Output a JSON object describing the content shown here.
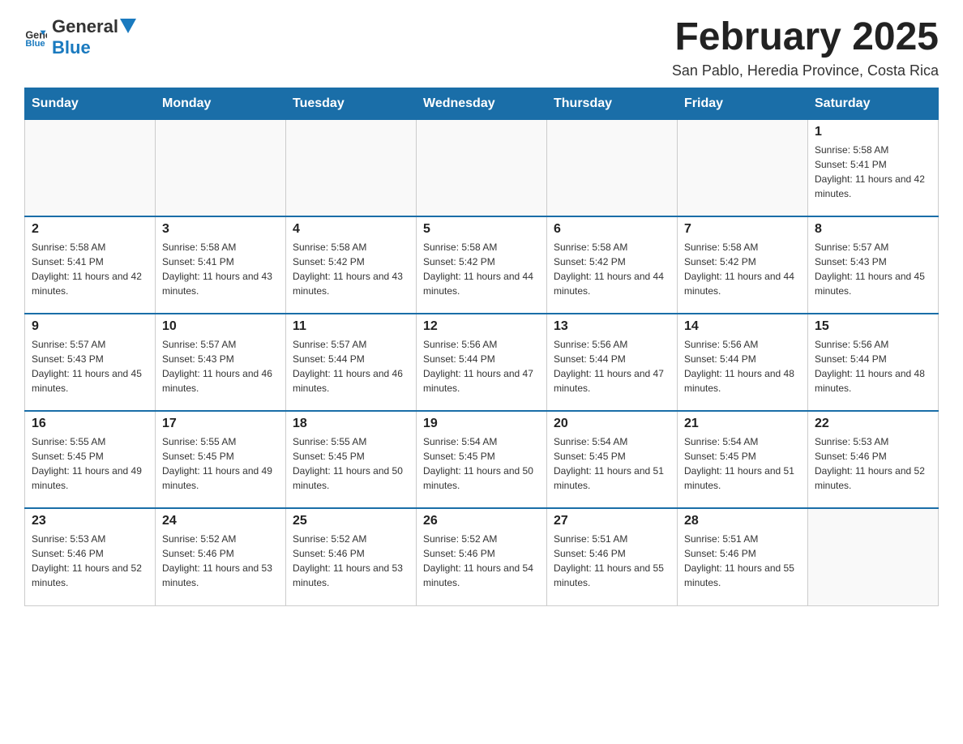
{
  "header": {
    "logo_general": "General",
    "logo_blue": "Blue",
    "title": "February 2025",
    "subtitle": "San Pablo, Heredia Province, Costa Rica"
  },
  "days_of_week": [
    "Sunday",
    "Monday",
    "Tuesday",
    "Wednesday",
    "Thursday",
    "Friday",
    "Saturday"
  ],
  "weeks": [
    [
      {
        "day": "",
        "sunrise": "",
        "sunset": "",
        "daylight": ""
      },
      {
        "day": "",
        "sunrise": "",
        "sunset": "",
        "daylight": ""
      },
      {
        "day": "",
        "sunrise": "",
        "sunset": "",
        "daylight": ""
      },
      {
        "day": "",
        "sunrise": "",
        "sunset": "",
        "daylight": ""
      },
      {
        "day": "",
        "sunrise": "",
        "sunset": "",
        "daylight": ""
      },
      {
        "day": "",
        "sunrise": "",
        "sunset": "",
        "daylight": ""
      },
      {
        "day": "1",
        "sunrise": "Sunrise: 5:58 AM",
        "sunset": "Sunset: 5:41 PM",
        "daylight": "Daylight: 11 hours and 42 minutes."
      }
    ],
    [
      {
        "day": "2",
        "sunrise": "Sunrise: 5:58 AM",
        "sunset": "Sunset: 5:41 PM",
        "daylight": "Daylight: 11 hours and 42 minutes."
      },
      {
        "day": "3",
        "sunrise": "Sunrise: 5:58 AM",
        "sunset": "Sunset: 5:41 PM",
        "daylight": "Daylight: 11 hours and 43 minutes."
      },
      {
        "day": "4",
        "sunrise": "Sunrise: 5:58 AM",
        "sunset": "Sunset: 5:42 PM",
        "daylight": "Daylight: 11 hours and 43 minutes."
      },
      {
        "day": "5",
        "sunrise": "Sunrise: 5:58 AM",
        "sunset": "Sunset: 5:42 PM",
        "daylight": "Daylight: 11 hours and 44 minutes."
      },
      {
        "day": "6",
        "sunrise": "Sunrise: 5:58 AM",
        "sunset": "Sunset: 5:42 PM",
        "daylight": "Daylight: 11 hours and 44 minutes."
      },
      {
        "day": "7",
        "sunrise": "Sunrise: 5:58 AM",
        "sunset": "Sunset: 5:42 PM",
        "daylight": "Daylight: 11 hours and 44 minutes."
      },
      {
        "day": "8",
        "sunrise": "Sunrise: 5:57 AM",
        "sunset": "Sunset: 5:43 PM",
        "daylight": "Daylight: 11 hours and 45 minutes."
      }
    ],
    [
      {
        "day": "9",
        "sunrise": "Sunrise: 5:57 AM",
        "sunset": "Sunset: 5:43 PM",
        "daylight": "Daylight: 11 hours and 45 minutes."
      },
      {
        "day": "10",
        "sunrise": "Sunrise: 5:57 AM",
        "sunset": "Sunset: 5:43 PM",
        "daylight": "Daylight: 11 hours and 46 minutes."
      },
      {
        "day": "11",
        "sunrise": "Sunrise: 5:57 AM",
        "sunset": "Sunset: 5:44 PM",
        "daylight": "Daylight: 11 hours and 46 minutes."
      },
      {
        "day": "12",
        "sunrise": "Sunrise: 5:56 AM",
        "sunset": "Sunset: 5:44 PM",
        "daylight": "Daylight: 11 hours and 47 minutes."
      },
      {
        "day": "13",
        "sunrise": "Sunrise: 5:56 AM",
        "sunset": "Sunset: 5:44 PM",
        "daylight": "Daylight: 11 hours and 47 minutes."
      },
      {
        "day": "14",
        "sunrise": "Sunrise: 5:56 AM",
        "sunset": "Sunset: 5:44 PM",
        "daylight": "Daylight: 11 hours and 48 minutes."
      },
      {
        "day": "15",
        "sunrise": "Sunrise: 5:56 AM",
        "sunset": "Sunset: 5:44 PM",
        "daylight": "Daylight: 11 hours and 48 minutes."
      }
    ],
    [
      {
        "day": "16",
        "sunrise": "Sunrise: 5:55 AM",
        "sunset": "Sunset: 5:45 PM",
        "daylight": "Daylight: 11 hours and 49 minutes."
      },
      {
        "day": "17",
        "sunrise": "Sunrise: 5:55 AM",
        "sunset": "Sunset: 5:45 PM",
        "daylight": "Daylight: 11 hours and 49 minutes."
      },
      {
        "day": "18",
        "sunrise": "Sunrise: 5:55 AM",
        "sunset": "Sunset: 5:45 PM",
        "daylight": "Daylight: 11 hours and 50 minutes."
      },
      {
        "day": "19",
        "sunrise": "Sunrise: 5:54 AM",
        "sunset": "Sunset: 5:45 PM",
        "daylight": "Daylight: 11 hours and 50 minutes."
      },
      {
        "day": "20",
        "sunrise": "Sunrise: 5:54 AM",
        "sunset": "Sunset: 5:45 PM",
        "daylight": "Daylight: 11 hours and 51 minutes."
      },
      {
        "day": "21",
        "sunrise": "Sunrise: 5:54 AM",
        "sunset": "Sunset: 5:45 PM",
        "daylight": "Daylight: 11 hours and 51 minutes."
      },
      {
        "day": "22",
        "sunrise": "Sunrise: 5:53 AM",
        "sunset": "Sunset: 5:46 PM",
        "daylight": "Daylight: 11 hours and 52 minutes."
      }
    ],
    [
      {
        "day": "23",
        "sunrise": "Sunrise: 5:53 AM",
        "sunset": "Sunset: 5:46 PM",
        "daylight": "Daylight: 11 hours and 52 minutes."
      },
      {
        "day": "24",
        "sunrise": "Sunrise: 5:52 AM",
        "sunset": "Sunset: 5:46 PM",
        "daylight": "Daylight: 11 hours and 53 minutes."
      },
      {
        "day": "25",
        "sunrise": "Sunrise: 5:52 AM",
        "sunset": "Sunset: 5:46 PM",
        "daylight": "Daylight: 11 hours and 53 minutes."
      },
      {
        "day": "26",
        "sunrise": "Sunrise: 5:52 AM",
        "sunset": "Sunset: 5:46 PM",
        "daylight": "Daylight: 11 hours and 54 minutes."
      },
      {
        "day": "27",
        "sunrise": "Sunrise: 5:51 AM",
        "sunset": "Sunset: 5:46 PM",
        "daylight": "Daylight: 11 hours and 55 minutes."
      },
      {
        "day": "28",
        "sunrise": "Sunrise: 5:51 AM",
        "sunset": "Sunset: 5:46 PM",
        "daylight": "Daylight: 11 hours and 55 minutes."
      },
      {
        "day": "",
        "sunrise": "",
        "sunset": "",
        "daylight": ""
      }
    ]
  ]
}
